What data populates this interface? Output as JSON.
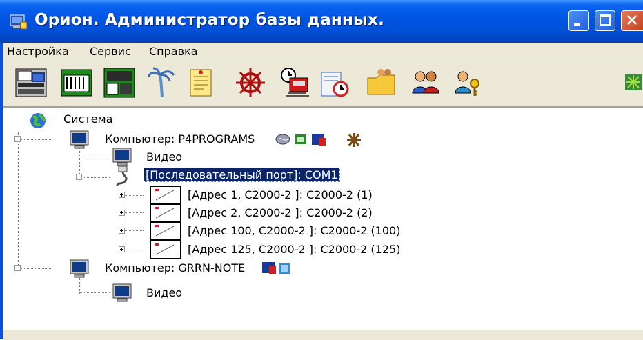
{
  "window": {
    "title": "Орион. Администратор базы данных."
  },
  "menu": {
    "items": [
      "Настройка",
      "Сервис",
      "Справка"
    ]
  },
  "toolbar": {
    "icons": [
      "computers-icon",
      "devices-icon",
      "controllers-icon",
      "palm-icon",
      "notes-icon",
      "helm-icon",
      "train-icon",
      "alarm-clock-icon",
      "folder-users-icon",
      "users-icon",
      "keys-icon",
      "network-status-icon"
    ]
  },
  "tree": {
    "root": "Система",
    "computer1": "Компьютер: P4PROGRAMS",
    "video1": "Видео",
    "port": "[Последовательный порт]: COM1",
    "devices": [
      "[Адрес 1, С2000-2 ]: С2000-2 (1)",
      "[Адрес 2, С2000-2 ]: С2000-2 (2)",
      "[Адрес 100, С2000-2 ]: С2000-2 (100)",
      "[Адрес 125, С2000-2 ]: С2000-2 (125)"
    ],
    "computer2": "Компьютер: GRRN-NOTE",
    "video2": "Видео"
  },
  "colors": {
    "titlebar": "#0054e3",
    "selection": "#0a246a",
    "window_bg": "#ece9d8"
  }
}
